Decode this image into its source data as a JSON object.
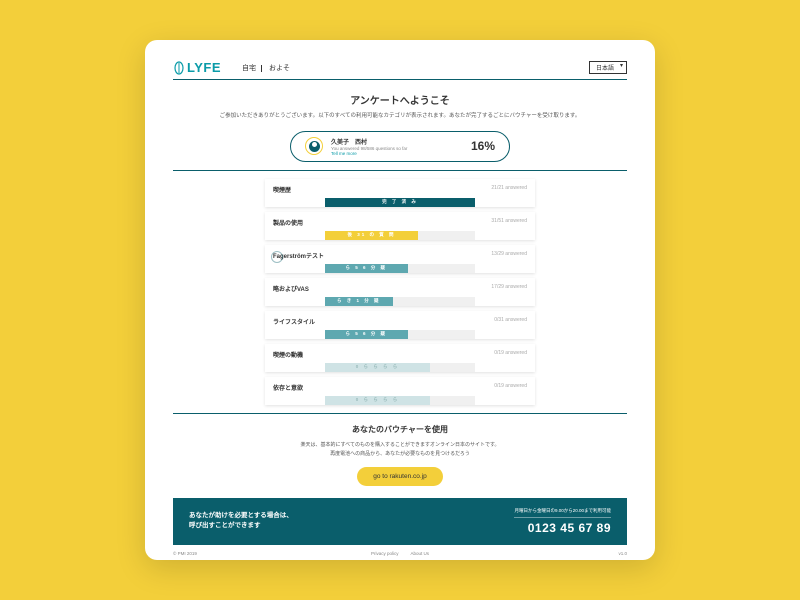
{
  "logo": "LYFE",
  "nav": {
    "home": "自宅",
    "about": "およそ"
  },
  "lang": "日本語",
  "welcome": {
    "title": "アンケートへようこそ",
    "desc": "ご参加いただきありがとうございます。以下のすべての利用可能なカテゴリが表示されます。あなたが完了するごとにバウチャーを受け取ります。"
  },
  "progress": {
    "name": "久美子　西村",
    "sub": "You answered 98/586 questions so far",
    "link": "Tell me more",
    "pct": "16%"
  },
  "sections": [
    {
      "title": "喫煙歴",
      "answered": "21/21 answered",
      "fill": "fill-dark",
      "label": "完 了 済 み"
    },
    {
      "title": "製品の使用",
      "answered": "31/51 answered",
      "fill": "fill-yellow",
      "label": "後 31 の 質 問"
    },
    {
      "title": "Fagerströmテスト",
      "answered": "13/29 answered",
      "fill": "fill-mid",
      "label": "ら 5 6 分 疑"
    },
    {
      "title": "略およびVAS",
      "answered": "17/29 answered",
      "fill": "fill-mid2",
      "label": "ら き 1 分 疑"
    },
    {
      "title": "ライフスタイル",
      "answered": "0/31 answered",
      "fill": "fill-mid",
      "label": "ら 5 6 分 疑"
    },
    {
      "title": "喫煙の動機",
      "answered": "0/19 answered",
      "fill": "fill-light",
      "label": "0 ら ら ら ら"
    },
    {
      "title": "依存と意欲",
      "answered": "0/19 answered",
      "fill": "fill-light",
      "label": "0 ら ら ら ら"
    }
  ],
  "voucher": {
    "title": "あなたのバウチャーを使用",
    "desc1": "楽天は、基本的にすべてのものを購入することができますオンライン日本のサイトです。",
    "desc2": "再度電池への商品から、あなたが必要なものを見つけるだろう",
    "button": "go to rakuten.co.jp"
  },
  "help": {
    "line1": "あなたが助けを必要とする場合は、",
    "line2": "呼び出すことができます",
    "hours": "月曜日から金曜日の9.00から20.00まで利用可能",
    "phone": "0123 45 67 89"
  },
  "footer": {
    "left": "© PMI 2019",
    "privacy": "Privacy policy",
    "about": "About Us",
    "right": "v1.0"
  }
}
